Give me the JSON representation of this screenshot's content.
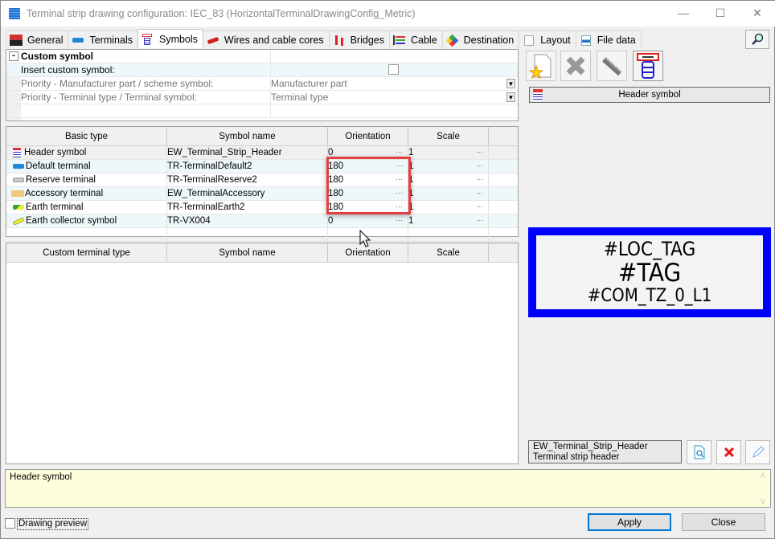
{
  "window": {
    "title": "Terminal strip drawing configuration: IEC_83 (HorizontalTerminalDrawingConfig_Metric)",
    "controls": [
      "minimize",
      "maximize",
      "close"
    ]
  },
  "tabs": [
    {
      "label": "General",
      "icon": "general-2021-icon",
      "active": false
    },
    {
      "label": "Terminals",
      "icon": "terminal-icon",
      "active": false
    },
    {
      "label": "Symbols",
      "icon": "symbol-stack-icon",
      "active": true
    },
    {
      "label": "Wires and cable cores",
      "icon": "wire-icon",
      "active": false
    },
    {
      "label": "Bridges",
      "icon": "bridge-icon",
      "active": false
    },
    {
      "label": "Cable",
      "icon": "cable-icon",
      "active": false
    },
    {
      "label": "Destination",
      "icon": "destination-icon",
      "active": false
    },
    {
      "label": "Layout",
      "icon": "layout-icon",
      "active": false
    },
    {
      "label": "File data",
      "icon": "file-data-icon",
      "active": false
    }
  ],
  "properties": {
    "group_toggle": "-",
    "group_label": "Custom symbol",
    "rows": [
      {
        "label": "Insert custom symbol:",
        "value": "",
        "type": "checkbox",
        "checked": false
      },
      {
        "label": "Priority - Manufacturer part / scheme symbol:",
        "value": "Manufacturer part",
        "type": "dropdown"
      },
      {
        "label": "Priority - Terminal type / Terminal symbol:",
        "value": "Terminal type",
        "type": "dropdown"
      }
    ]
  },
  "basic_grid": {
    "columns": [
      "Basic type",
      "Symbol name",
      "Orientation",
      "Scale"
    ],
    "rows": [
      {
        "type": "Header symbol",
        "symbol": "EW_Terminal_Strip_Header",
        "orientation": "0",
        "scale": "1",
        "icon": "header-symbol-icon"
      },
      {
        "type": "Default terminal",
        "symbol": "TR-TerminalDefault2",
        "orientation": "180",
        "scale": "1",
        "icon": "default-terminal-icon"
      },
      {
        "type": "Reserve terminal",
        "symbol": "TR-TerminalReserve2",
        "orientation": "180",
        "scale": "1",
        "icon": "reserve-terminal-icon"
      },
      {
        "type": "Accessory terminal",
        "symbol": "EW_TerminalAccessory",
        "orientation": "180",
        "scale": "1",
        "icon": "accessory-terminal-icon"
      },
      {
        "type": "Earth terminal",
        "symbol": "TR-TerminalEarth2",
        "orientation": "180",
        "scale": "1",
        "icon": "earth-terminal-icon"
      },
      {
        "type": "Earth collector symbol",
        "symbol": "TR-VX004",
        "orientation": "0",
        "scale": "1",
        "icon": "earth-collector-icon"
      }
    ],
    "ellipsis": "···"
  },
  "custom_grid": {
    "columns": [
      "Custom terminal type",
      "Symbol name",
      "Orientation",
      "Scale"
    ],
    "rows": []
  },
  "right_panel": {
    "toolbar": [
      {
        "name": "new-symbol",
        "icon": "new-document-icon"
      },
      {
        "name": "delete-symbol",
        "icon": "delete-icon"
      },
      {
        "name": "edit-symbol",
        "icon": "comb-icon"
      },
      {
        "name": "header-symbol",
        "icon": "header-symbol-icon"
      }
    ],
    "selected_label": "Header symbol",
    "preview": {
      "line1": "#LOC_TAG",
      "line2": "#TAG",
      "line3": "#COM_TZ_0_L1",
      "border_color": "#0000ff"
    },
    "symbol_info": {
      "name": "EW_Terminal_Strip_Header",
      "description": "Terminal strip header"
    }
  },
  "description_box": "Header symbol",
  "footer": {
    "drawing_preview_label": "Drawing preview",
    "drawing_preview_checked": false,
    "apply_label": "Apply",
    "close_label": "Close"
  },
  "colors": {
    "highlight": "#e04040",
    "description_bg": "#fffedc",
    "accent": "#0078d7"
  }
}
